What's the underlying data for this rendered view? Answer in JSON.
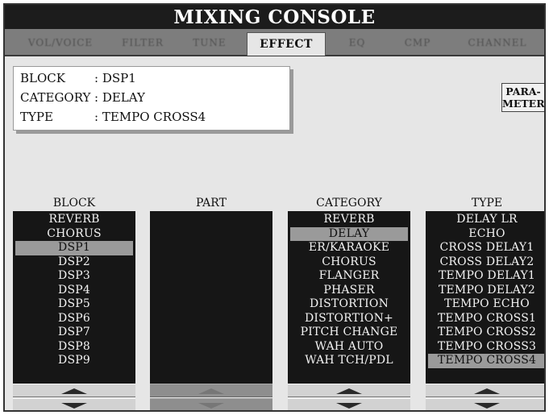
{
  "title": "MIXING CONSOLE",
  "tabs": [
    {
      "label": "VOL/VOICE",
      "active": false
    },
    {
      "label": "FILTER",
      "active": false
    },
    {
      "label": "TUNE",
      "active": false
    },
    {
      "label": "EFFECT",
      "active": true
    },
    {
      "label": "EQ",
      "active": false
    },
    {
      "label": "CMP",
      "active": false
    },
    {
      "label": "CHANNEL",
      "active": false
    }
  ],
  "info": {
    "block_label": "BLOCK",
    "block_value": ": DSP1",
    "category_label": "CATEGORY",
    "category_value": ": DELAY",
    "type_label": "TYPE",
    "type_value": ": TEMPO CROSS4"
  },
  "parameter_button": {
    "line1": "PARA-",
    "line2": "METER"
  },
  "columns": {
    "block": {
      "header": "BLOCK",
      "items": [
        "REVERB",
        "CHORUS",
        "DSP1",
        "DSP2",
        "DSP3",
        "DSP4",
        "DSP5",
        "DSP6",
        "DSP7",
        "DSP8",
        "DSP9"
      ],
      "selected": "DSP1"
    },
    "part": {
      "header": "PART",
      "items": []
    },
    "category": {
      "header": "CATEGORY",
      "items": [
        "REVERB",
        "DELAY",
        "ER/KARAOKE",
        "CHORUS",
        "FLANGER",
        "PHASER",
        "DISTORTION",
        "DISTORTION+",
        "PITCH CHANGE",
        "WAH AUTO",
        "WAH TCH/PDL"
      ],
      "selected": "DELAY"
    },
    "type": {
      "header": "TYPE",
      "items": [
        "DELAY LR",
        "ECHO",
        "CROSS DELAY1",
        "CROSS DELAY2",
        "TEMPO DELAY1",
        "TEMPO DELAY2",
        "TEMPO ECHO",
        "TEMPO CROSS1",
        "TEMPO CROSS2",
        "TEMPO CROSS3",
        "TEMPO CROSS4"
      ],
      "selected": "TEMPO CROSS4"
    }
  },
  "colors": {
    "title_bg": "#1c1c1c",
    "list_bg": "#161616",
    "selected_bg": "#9a9a9a",
    "screen_bg": "#e6e6e6"
  }
}
